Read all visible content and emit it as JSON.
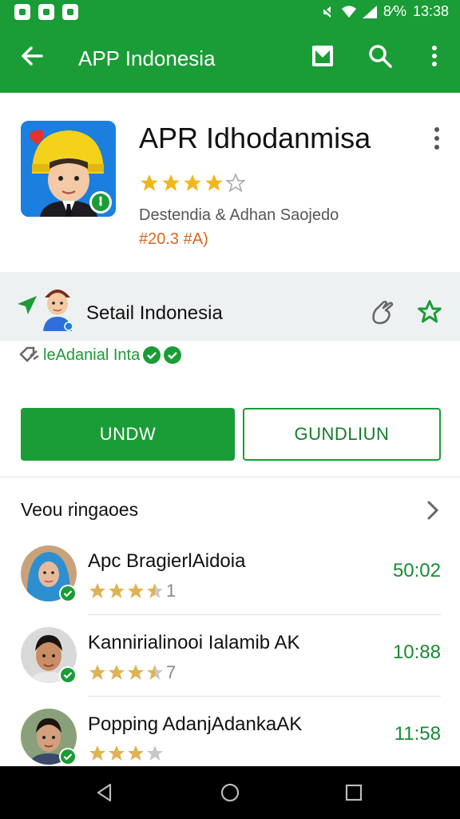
{
  "status_bar": {
    "battery_text": "8⁄%",
    "time": "13:38"
  },
  "app_bar": {
    "title": "APP Indonesia"
  },
  "app": {
    "title": "APR Idhodanmisa",
    "rating_stars": 4,
    "developer": "Destendia & Adhan Saojedo",
    "price": "#20.3 #A)"
  },
  "section": {
    "title": "Setail Indonesia",
    "tagline": "leAdanial Inta"
  },
  "buttons": {
    "primary": "UNDW",
    "secondary": "GUNDLIUN"
  },
  "reviews": {
    "heading": "Veou ringaoes",
    "items": [
      {
        "name": "Apc BragierlAidoia",
        "stars": 3.5,
        "count": "1",
        "time": "50:02",
        "avatar": "hijab-avatar"
      },
      {
        "name": "Kannirialinooi Ialamib AK",
        "stars": 3.5,
        "count": "7",
        "time": "10:88",
        "avatar": "boy-avatar"
      },
      {
        "name": "Popping AdanjAdankaAK",
        "stars": 3,
        "count": "",
        "time": "11:58",
        "avatar": "boy-avatar-2"
      }
    ]
  },
  "colors": {
    "brand_green": "#1a9c36",
    "star_gold": "#f2b51b",
    "price_orange": "#d8671c"
  }
}
